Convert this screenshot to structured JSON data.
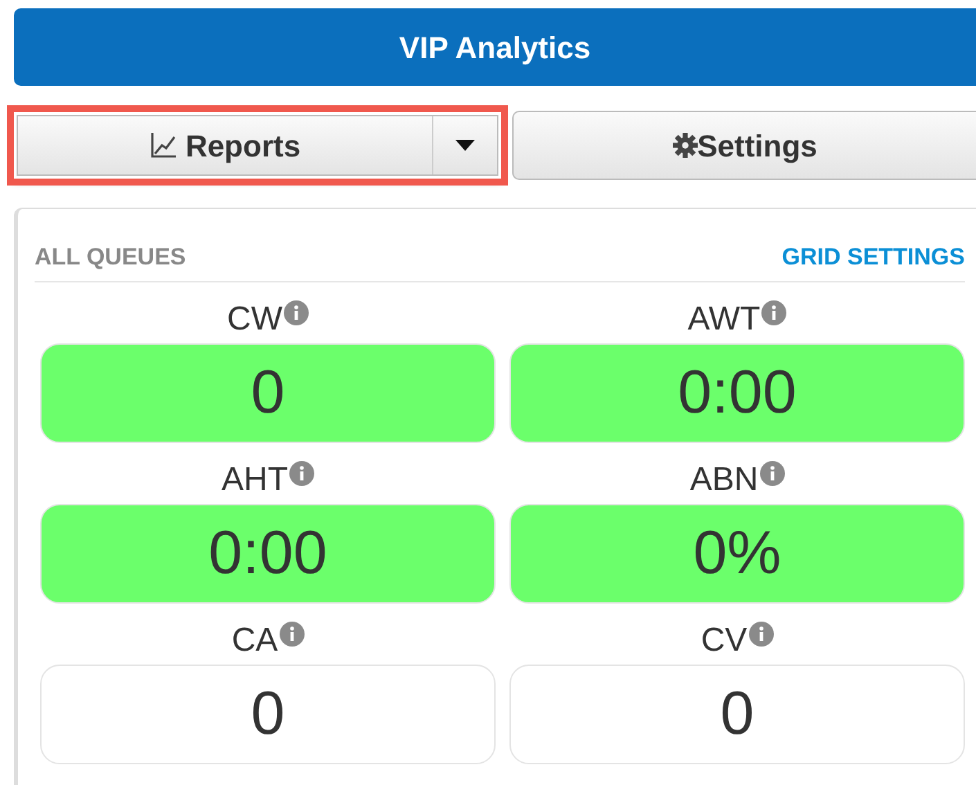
{
  "header": {
    "title": "VIP Analytics"
  },
  "toolbar": {
    "reports": {
      "label": "Reports",
      "highlighted": true
    },
    "settings": {
      "label": "Settings"
    }
  },
  "panel": {
    "title": "ALL QUEUES",
    "link": "GRID SETTINGS",
    "metrics": [
      {
        "label": "CW",
        "value": "0",
        "color": "#6bff6b"
      },
      {
        "label": "AWT",
        "value": "0:00",
        "color": "#6bff6b"
      },
      {
        "label": "AHT",
        "value": "0:00",
        "color": "#6bff6b"
      },
      {
        "label": "ABN",
        "value": "0%",
        "color": "#6bff6b"
      },
      {
        "label": "CA",
        "value": "0",
        "color": "#ffffff"
      },
      {
        "label": "CV",
        "value": "0",
        "color": "#ffffff"
      }
    ]
  }
}
